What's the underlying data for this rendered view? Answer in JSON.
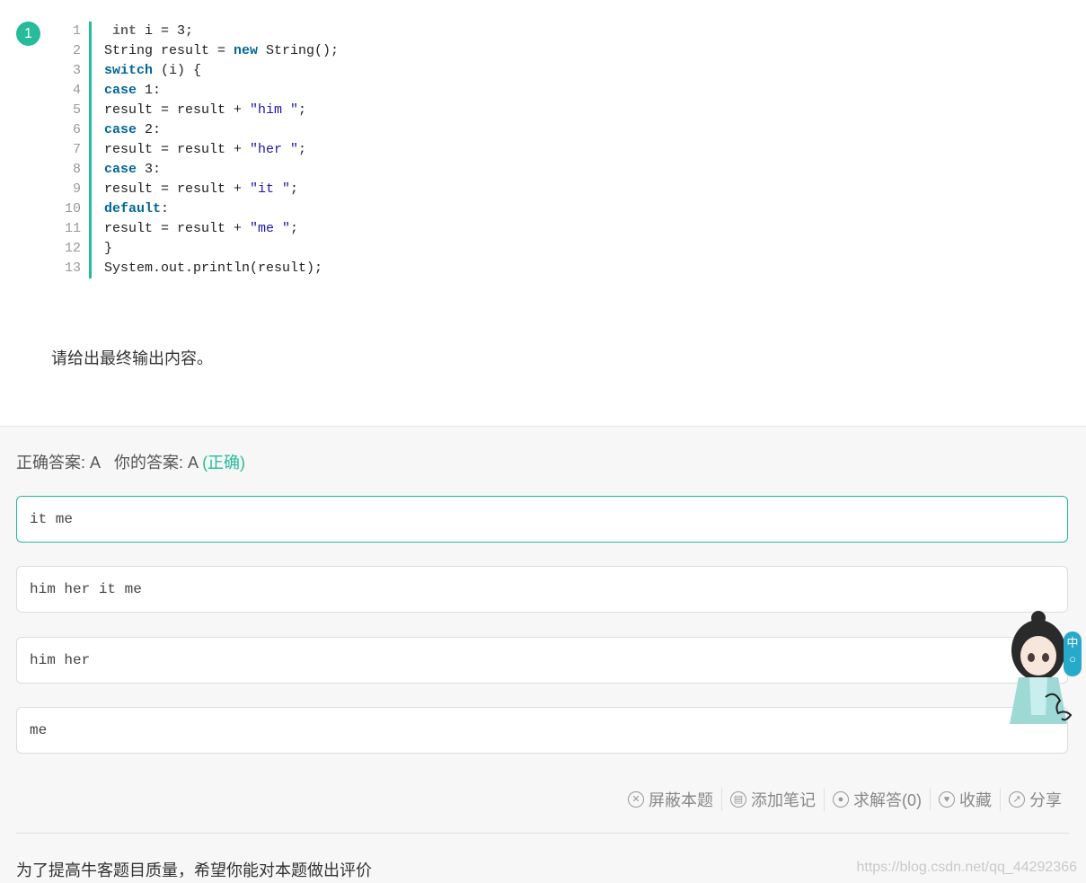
{
  "question": {
    "number": "1",
    "code_lines": [
      {
        "num": "1",
        "tokens": [
          {
            "t": " ",
            "c": "plain"
          },
          {
            "t": "int",
            "c": "plain-bold"
          },
          {
            "t": " i = 3;",
            "c": "plain"
          }
        ]
      },
      {
        "num": "2",
        "tokens": [
          {
            "t": "String result = ",
            "c": "plain"
          },
          {
            "t": "new",
            "c": "kw"
          },
          {
            "t": " String();",
            "c": "plain"
          }
        ]
      },
      {
        "num": "3",
        "tokens": [
          {
            "t": "switch",
            "c": "kw"
          },
          {
            "t": " (i) {",
            "c": "plain"
          }
        ]
      },
      {
        "num": "4",
        "tokens": [
          {
            "t": "case",
            "c": "kw"
          },
          {
            "t": " 1:",
            "c": "plain"
          }
        ]
      },
      {
        "num": "5",
        "tokens": [
          {
            "t": "result = result + ",
            "c": "plain"
          },
          {
            "t": "\"him \"",
            "c": "str"
          },
          {
            "t": ";",
            "c": "plain"
          }
        ]
      },
      {
        "num": "6",
        "tokens": [
          {
            "t": "case",
            "c": "kw"
          },
          {
            "t": " 2:",
            "c": "plain"
          }
        ]
      },
      {
        "num": "7",
        "tokens": [
          {
            "t": "result = result + ",
            "c": "plain"
          },
          {
            "t": "\"her \"",
            "c": "str"
          },
          {
            "t": ";",
            "c": "plain"
          }
        ]
      },
      {
        "num": "8",
        "tokens": [
          {
            "t": "case",
            "c": "kw"
          },
          {
            "t": " 3:",
            "c": "plain"
          }
        ]
      },
      {
        "num": "9",
        "tokens": [
          {
            "t": "result = result + ",
            "c": "plain"
          },
          {
            "t": "\"it \"",
            "c": "str"
          },
          {
            "t": ";",
            "c": "plain"
          }
        ]
      },
      {
        "num": "10",
        "tokens": [
          {
            "t": "default",
            "c": "kw"
          },
          {
            "t": ":",
            "c": "plain"
          }
        ]
      },
      {
        "num": "11",
        "tokens": [
          {
            "t": "result = result + ",
            "c": "plain"
          },
          {
            "t": "\"me \"",
            "c": "str"
          },
          {
            "t": ";",
            "c": "plain"
          }
        ]
      },
      {
        "num": "12",
        "tokens": [
          {
            "t": "}",
            "c": "plain"
          }
        ]
      },
      {
        "num": "13",
        "tokens": [
          {
            "t": "System.out.println(result);",
            "c": "plain"
          }
        ]
      }
    ],
    "prompt": "请给出最终输出内容。"
  },
  "result": {
    "correct_label": "正确答案: A",
    "your_label": "你的答案: A",
    "status": "(正确)"
  },
  "options": [
    {
      "text": "it me",
      "selected": true
    },
    {
      "text": "him her it me",
      "selected": false
    },
    {
      "text": "him her",
      "selected": false
    },
    {
      "text": "me",
      "selected": false
    }
  ],
  "actions": {
    "block": "屏蔽本题",
    "note": "添加笔记",
    "ask": "求解答(0)",
    "favorite": "收藏",
    "share": "分享"
  },
  "evaluation_prompt": "为了提高牛客题目质量，希望你能对本题做出评价",
  "lang_tab": "中",
  "watermark": "https://blog.csdn.net/qq_44292366",
  "colors": {
    "accent": "#25bb9b",
    "keyword": "#006699",
    "string": "#1a1aa6"
  }
}
